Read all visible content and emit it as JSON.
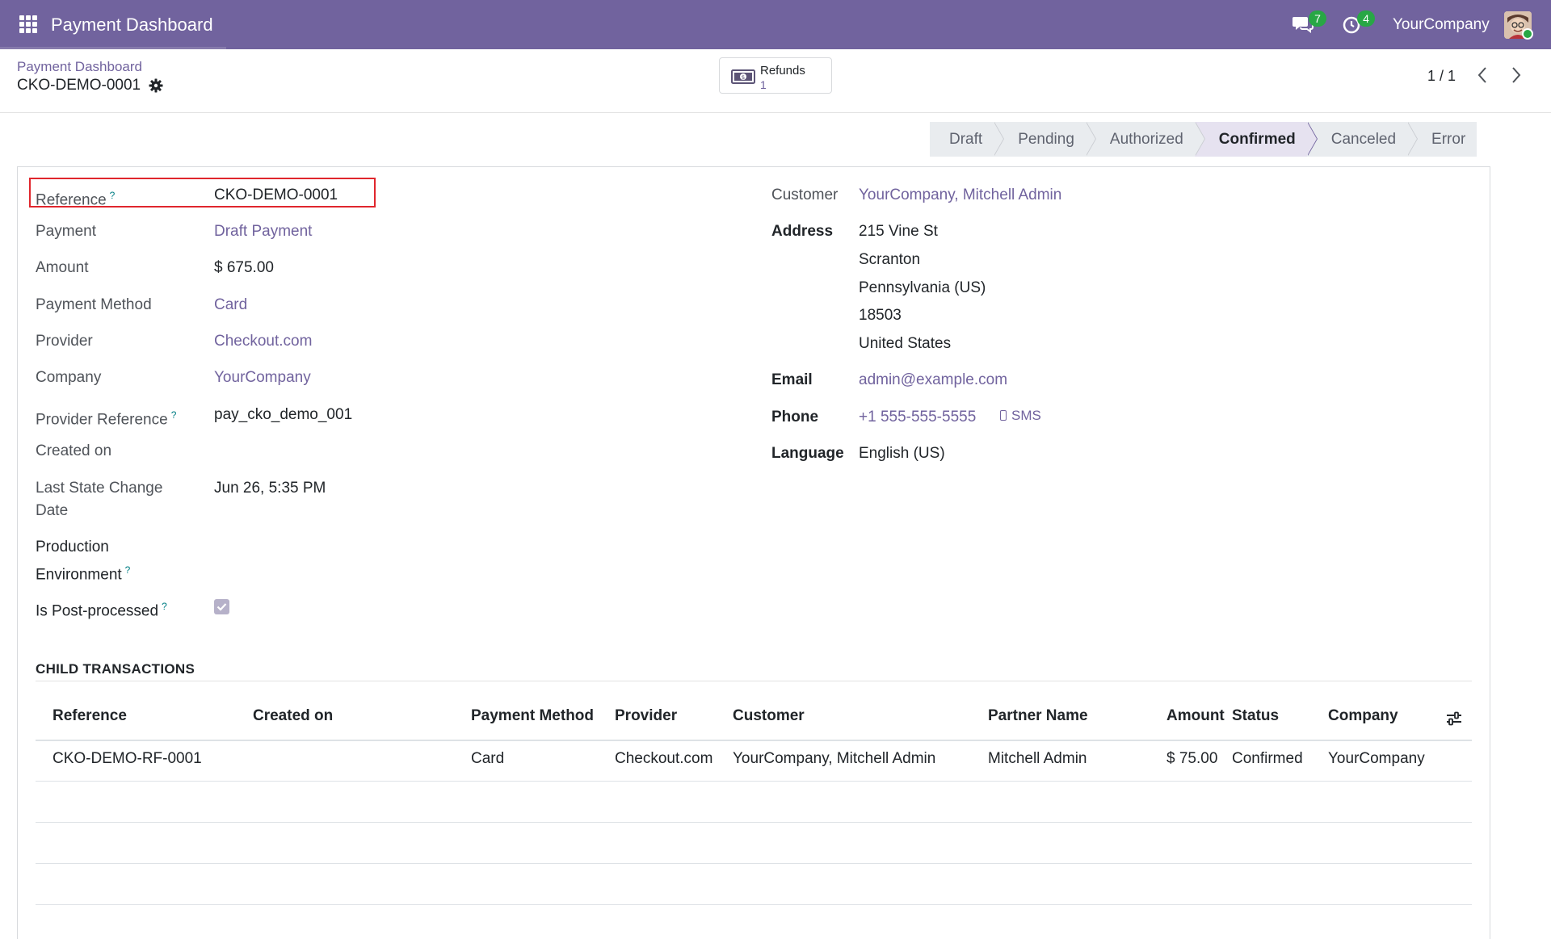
{
  "navbar": {
    "app_title": "Payment Dashboard",
    "chat_count": "7",
    "activity_count": "4",
    "company": "YourCompany",
    "color": "#71639e"
  },
  "control_panel": {
    "breadcrumb": "Payment Dashboard",
    "record_title": "CKO-DEMO-0001",
    "refunds_label": "Refunds",
    "refunds_count": "1",
    "pager": "1 / 1"
  },
  "statusbar": {
    "stages": [
      "Draft",
      "Pending",
      "Authorized",
      "Confirmed",
      "Canceled",
      "Error"
    ],
    "active": "Confirmed"
  },
  "form": {
    "left": {
      "reference_label": "Reference",
      "reference_value": "CKO-DEMO-0001",
      "payment_label": "Payment",
      "payment_value": "Draft Payment",
      "amount_label": "Amount",
      "amount_value": "$ 675.00",
      "payment_method_label": "Payment Method",
      "payment_method_value": "Card",
      "provider_label": "Provider",
      "provider_value": "Checkout.com",
      "company_label": "Company",
      "company_value": "YourCompany",
      "provider_ref_label": "Provider Reference",
      "provider_ref_value": "pay_cko_demo_001",
      "created_on_label": "Created on",
      "last_state_label_1": "Last State Change",
      "last_state_label_2": "Date",
      "last_state_value": "Jun 26, 5:35 PM",
      "production_label_1": "Production",
      "production_label_2": "Environment",
      "post_processed_label": "Is Post-processed",
      "post_processed_value": true
    },
    "right": {
      "customer_label": "Customer",
      "customer_value": "YourCompany, Mitchell Admin",
      "address_label": "Address",
      "address_lines": [
        "215 Vine St",
        "Scranton",
        "Pennsylvania (US)",
        "18503",
        "United States"
      ],
      "email_label": "Email",
      "email_value": "admin@example.com",
      "phone_label": "Phone",
      "phone_value": "+1 555-555-5555",
      "sms_label": "SMS",
      "language_label": "Language",
      "language_value": "English (US)"
    },
    "help_mark": "?"
  },
  "child_transactions": {
    "title": "CHILD TRANSACTIONS",
    "columns": [
      "Reference",
      "Created on",
      "Payment Method",
      "Provider",
      "Customer",
      "Partner Name",
      "Amount",
      "Status",
      "Company"
    ],
    "rows": [
      [
        "CKO-DEMO-RF-0001",
        "",
        "Card",
        "Checkout.com",
        "YourCompany, Mitchell Admin",
        "Mitchell Admin",
        "$ 75.00",
        "Confirmed",
        "YourCompany"
      ]
    ]
  }
}
